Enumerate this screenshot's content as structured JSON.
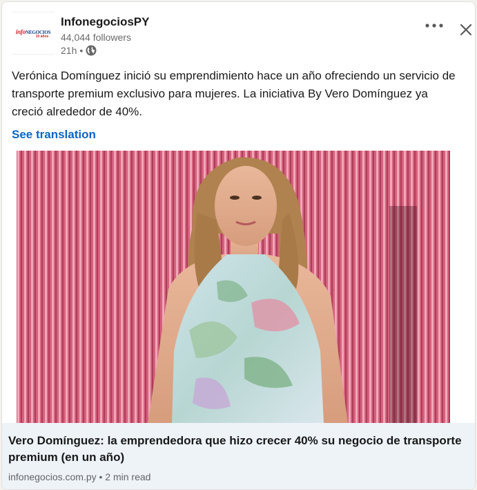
{
  "post": {
    "author_name": "InfonegociosPY",
    "followers": "44,044 followers",
    "time": "21h",
    "separator": "•",
    "logo_text_1": "info",
    "logo_text_2": "NEGOCIOS",
    "logo_text_3": "10 años",
    "body": "Verónica Domínguez inició su emprendimiento hace un año ofreciendo un servicio de transporte premium exclusivo para mujeres. La iniciativa By Vero Domínguez ya creció alrededor de 40%.",
    "see_translation": "See translation"
  },
  "link": {
    "title": "Vero Domínguez: la emprendedora que hizo crecer 40% su negocio de transporte premium (en un año)",
    "meta": "infonegocios.com.py • 2 min read"
  },
  "icons": {
    "more": "more-options-icon",
    "close": "close-icon",
    "visibility": "globe-icon"
  },
  "colors": {
    "link_blue": "#0a66c2",
    "link_box_bg": "#eef3f8"
  }
}
